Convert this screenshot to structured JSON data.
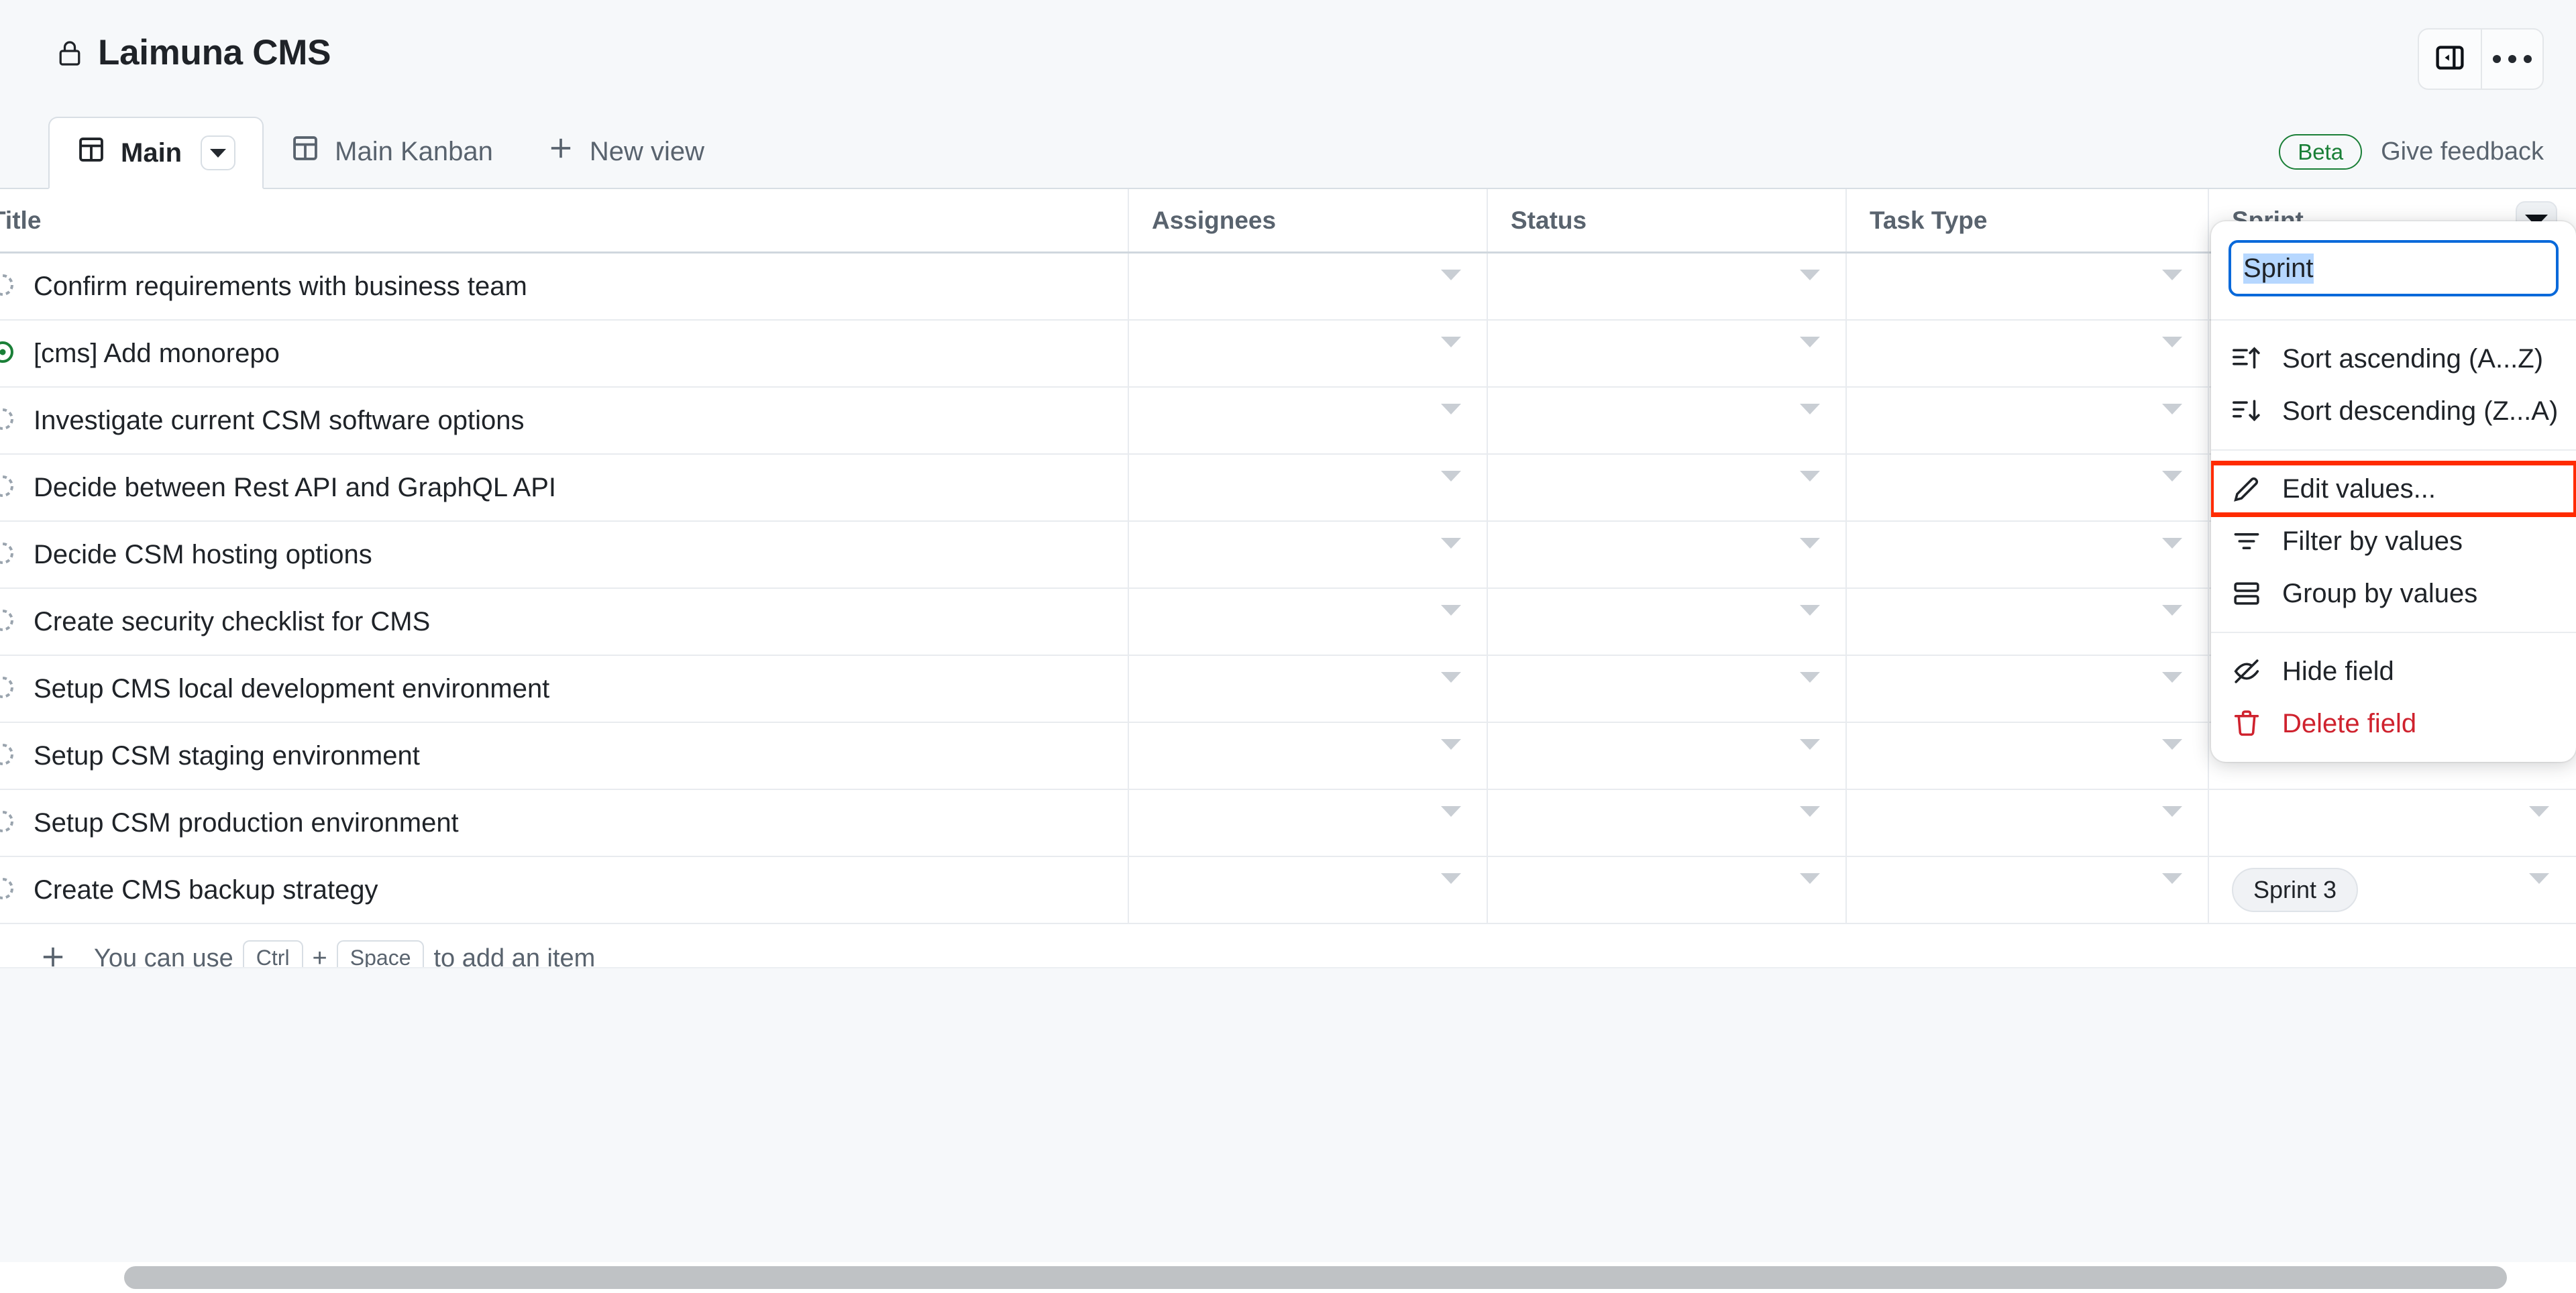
{
  "window": {
    "project_title": "Laimuna CMS",
    "lock_icon": "lock-icon",
    "sidebar_toggle_icon": "panel-collapse-icon",
    "more_options_icon": "kebab-menu-icon"
  },
  "tabs": {
    "items": [
      {
        "label": "Main",
        "icon": "table-view-icon",
        "active": true,
        "has_caret": true
      },
      {
        "label": "Main Kanban",
        "icon": "table-view-icon",
        "active": false,
        "has_caret": false
      }
    ],
    "new_view_label": "New view",
    "new_view_icon": "plus-icon"
  },
  "status_bar": {
    "beta_label": "Beta",
    "feedback_label": "Give feedback",
    "beta_color": "#1a7f37"
  },
  "table": {
    "columns": [
      {
        "key": "title",
        "label": "Title",
        "truncated": true
      },
      {
        "key": "assignees",
        "label": "Assignees"
      },
      {
        "key": "status",
        "label": "Status"
      },
      {
        "key": "tasktype",
        "label": "Task Type"
      },
      {
        "key": "sprint",
        "label": "Sprint",
        "has_menu_caret": true
      }
    ],
    "rows": [
      {
        "title": "Confirm requirements with business team",
        "icon": "draft-issue-icon",
        "sprint": ""
      },
      {
        "title": "[cms] Add monorepo",
        "icon": "open-issue-icon",
        "sprint": ""
      },
      {
        "title": "Investigate current CSM software options",
        "icon": "draft-issue-icon",
        "sprint": ""
      },
      {
        "title": "Decide between Rest API and GraphQL API",
        "icon": "draft-issue-icon",
        "sprint": ""
      },
      {
        "title": "Decide CSM hosting options",
        "icon": "draft-issue-icon",
        "sprint": ""
      },
      {
        "title": "Create security checklist for CMS",
        "icon": "draft-issue-icon",
        "sprint": ""
      },
      {
        "title": "Setup CMS local development environment",
        "icon": "draft-issue-icon",
        "sprint": ""
      },
      {
        "title": "Setup CSM staging environment",
        "icon": "draft-issue-icon",
        "sprint": ""
      },
      {
        "title": "Setup CSM production environment",
        "icon": "draft-issue-icon",
        "sprint": ""
      },
      {
        "title": "Create CMS backup strategy",
        "icon": "draft-issue-icon",
        "sprint": "Sprint 3"
      }
    ],
    "add_item": {
      "plus_icon": "plus-icon",
      "text_before": "You can use",
      "key1": "Ctrl",
      "plus_sign": "+",
      "key2": "Space",
      "text_after": "to add an item"
    }
  },
  "field_menu": {
    "input_value": "Sprint",
    "input_selected": true,
    "focus_color": "#0969da",
    "selection_color": "#b6d7ff",
    "groups": [
      {
        "items": [
          {
            "label": "Sort ascending (A...Z)",
            "icon": "sort-ascending-icon",
            "highlighted": false,
            "danger": false
          },
          {
            "label": "Sort descending (Z...A)",
            "icon": "sort-descending-icon",
            "highlighted": false,
            "danger": false
          }
        ]
      },
      {
        "items": [
          {
            "label": "Edit values...",
            "icon": "pencil-icon",
            "highlighted": true,
            "danger": false
          },
          {
            "label": "Filter by values",
            "icon": "filter-icon",
            "highlighted": false,
            "danger": false
          },
          {
            "label": "Group by values",
            "icon": "group-rows-icon",
            "highlighted": false,
            "danger": false
          }
        ]
      },
      {
        "items": [
          {
            "label": "Hide field",
            "icon": "eye-closed-icon",
            "highlighted": false,
            "danger": false
          },
          {
            "label": "Delete field",
            "icon": "trash-icon",
            "highlighted": false,
            "danger": true
          }
        ]
      }
    ],
    "highlight_color": "#ff2b00",
    "danger_color": "#cf222e"
  },
  "scrollbar": {
    "orientation": "horizontal",
    "thumb_color": "#bfc2c5"
  }
}
